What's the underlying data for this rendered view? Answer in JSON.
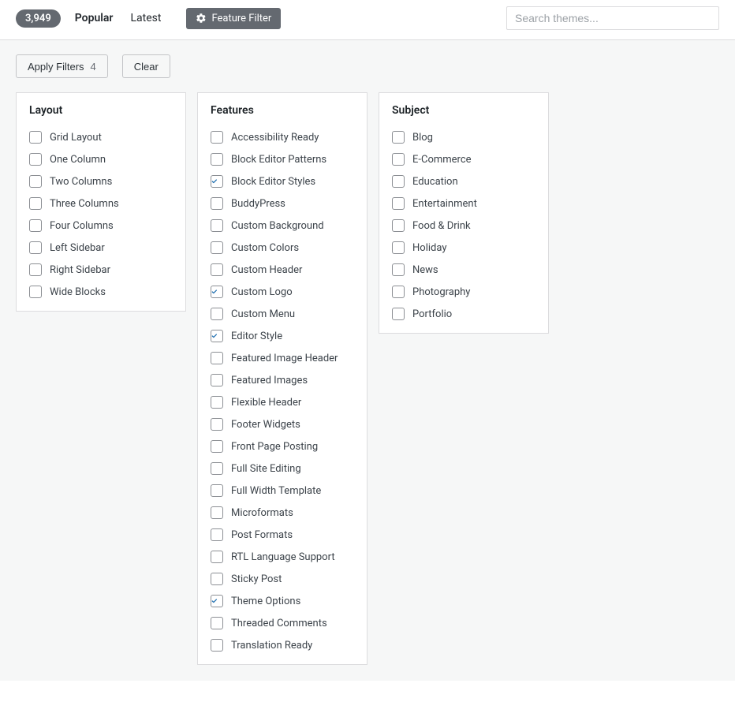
{
  "toolbar": {
    "count": "3,949",
    "tabs": {
      "popular": "Popular",
      "latest": "Latest"
    },
    "feature_filter": "Feature Filter",
    "search_placeholder": "Search themes..."
  },
  "buttons": {
    "apply": "Apply Filters",
    "apply_count": "4",
    "clear": "Clear"
  },
  "panels": {
    "layout": {
      "title": "Layout",
      "items": [
        {
          "label": "Grid Layout",
          "checked": false
        },
        {
          "label": "One Column",
          "checked": false
        },
        {
          "label": "Two Columns",
          "checked": false
        },
        {
          "label": "Three Columns",
          "checked": false
        },
        {
          "label": "Four Columns",
          "checked": false
        },
        {
          "label": "Left Sidebar",
          "checked": false
        },
        {
          "label": "Right Sidebar",
          "checked": false
        },
        {
          "label": "Wide Blocks",
          "checked": false
        }
      ]
    },
    "features": {
      "title": "Features",
      "items": [
        {
          "label": "Accessibility Ready",
          "checked": false
        },
        {
          "label": "Block Editor Patterns",
          "checked": false
        },
        {
          "label": "Block Editor Styles",
          "checked": true
        },
        {
          "label": "BuddyPress",
          "checked": false
        },
        {
          "label": "Custom Background",
          "checked": false
        },
        {
          "label": "Custom Colors",
          "checked": false
        },
        {
          "label": "Custom Header",
          "checked": false
        },
        {
          "label": "Custom Logo",
          "checked": true
        },
        {
          "label": "Custom Menu",
          "checked": false
        },
        {
          "label": "Editor Style",
          "checked": true
        },
        {
          "label": "Featured Image Header",
          "checked": false
        },
        {
          "label": "Featured Images",
          "checked": false
        },
        {
          "label": "Flexible Header",
          "checked": false
        },
        {
          "label": "Footer Widgets",
          "checked": false
        },
        {
          "label": "Front Page Posting",
          "checked": false
        },
        {
          "label": "Full Site Editing",
          "checked": false
        },
        {
          "label": "Full Width Template",
          "checked": false
        },
        {
          "label": "Microformats",
          "checked": false
        },
        {
          "label": "Post Formats",
          "checked": false
        },
        {
          "label": "RTL Language Support",
          "checked": false
        },
        {
          "label": "Sticky Post",
          "checked": false
        },
        {
          "label": "Theme Options",
          "checked": true
        },
        {
          "label": "Threaded Comments",
          "checked": false
        },
        {
          "label": "Translation Ready",
          "checked": false
        }
      ]
    },
    "subject": {
      "title": "Subject",
      "items": [
        {
          "label": "Blog",
          "checked": false
        },
        {
          "label": "E-Commerce",
          "checked": false
        },
        {
          "label": "Education",
          "checked": false
        },
        {
          "label": "Entertainment",
          "checked": false
        },
        {
          "label": "Food & Drink",
          "checked": false
        },
        {
          "label": "Holiday",
          "checked": false
        },
        {
          "label": "News",
          "checked": false
        },
        {
          "label": "Photography",
          "checked": false
        },
        {
          "label": "Portfolio",
          "checked": false
        }
      ]
    }
  }
}
